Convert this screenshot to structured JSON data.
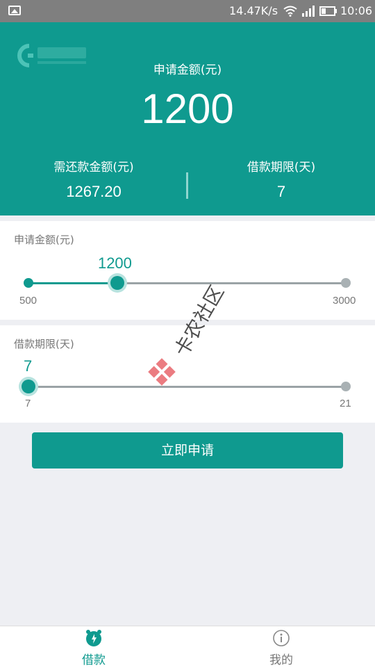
{
  "status_bar": {
    "network_speed": "14.47K/s",
    "time": "10:06"
  },
  "header": {
    "apply_amount_label": "申请金额(元)",
    "apply_amount_value": "1200",
    "repay_label": "需还款金额(元)",
    "repay_value": "1267.20",
    "term_label": "借款期限(天)",
    "term_value": "7"
  },
  "amount_slider": {
    "label": "申请金额(元)",
    "value": "1200",
    "min": "500",
    "max": "3000",
    "fraction": 0.28
  },
  "term_slider": {
    "label": "借款期限(天)",
    "value": "7",
    "min": "7",
    "max": "21",
    "fraction": 0.0
  },
  "apply_button": {
    "label": "立即申请"
  },
  "watermark": {
    "text": "卡农社区"
  },
  "bottom_nav": [
    {
      "label": "借款",
      "icon": "loan-icon",
      "active": true
    },
    {
      "label": "我的",
      "icon": "info-icon",
      "active": false
    }
  ],
  "colors": {
    "primary": "#0f9a8f",
    "status_bar": "#7f7f7f",
    "background": "#eeeff3"
  }
}
